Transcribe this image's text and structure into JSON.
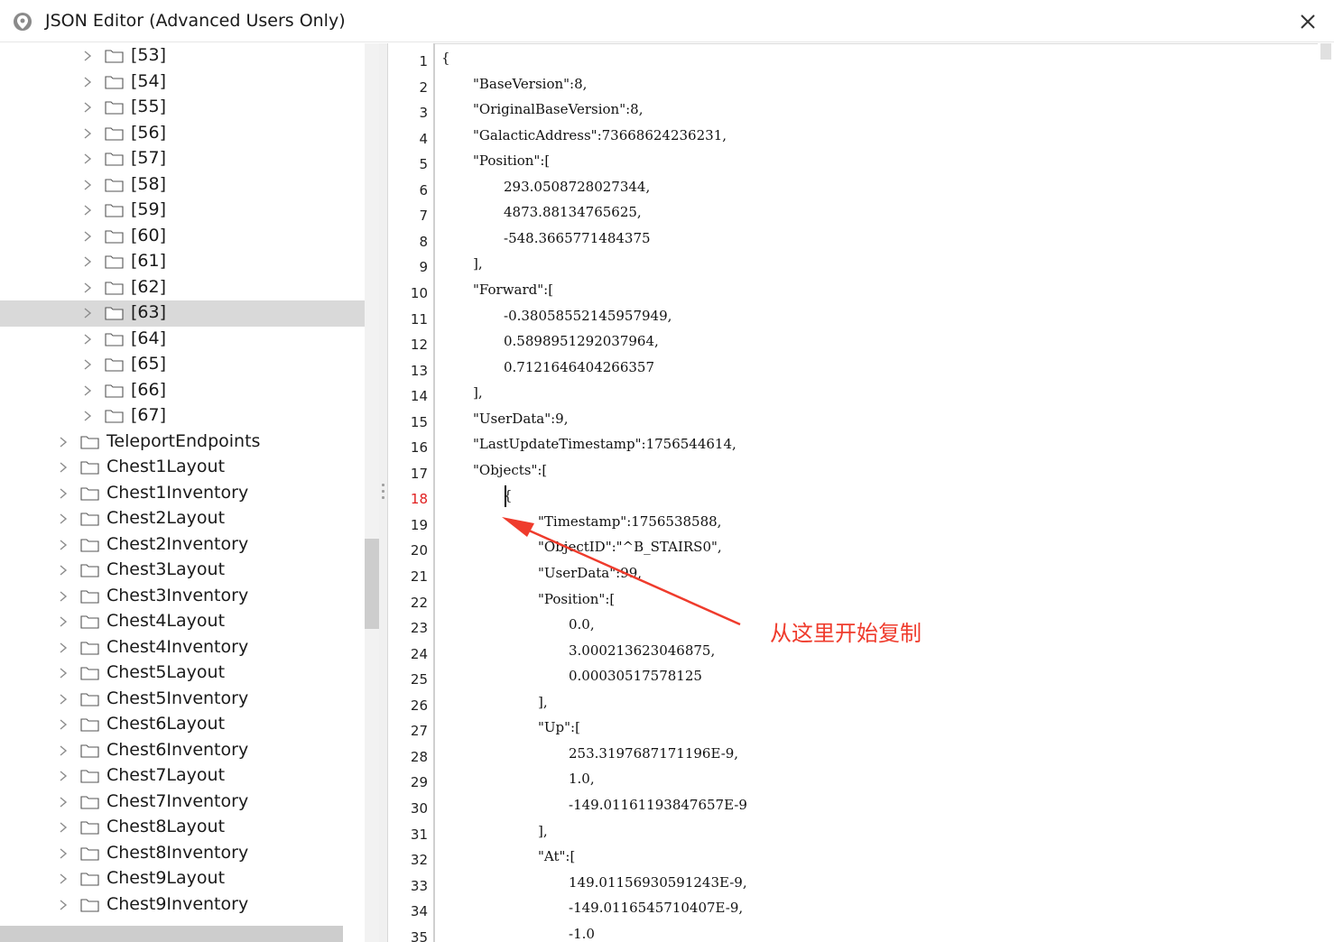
{
  "window": {
    "title": "JSON Editor (Advanced Users Only)"
  },
  "tree": {
    "items": [
      {
        "label": "[53]",
        "level": 2
      },
      {
        "label": "[54]",
        "level": 2
      },
      {
        "label": "[55]",
        "level": 2
      },
      {
        "label": "[56]",
        "level": 2
      },
      {
        "label": "[57]",
        "level": 2
      },
      {
        "label": "[58]",
        "level": 2
      },
      {
        "label": "[59]",
        "level": 2
      },
      {
        "label": "[60]",
        "level": 2
      },
      {
        "label": "[61]",
        "level": 2
      },
      {
        "label": "[62]",
        "level": 2
      },
      {
        "label": "[63]",
        "level": 2,
        "selected": true
      },
      {
        "label": "[64]",
        "level": 2
      },
      {
        "label": "[65]",
        "level": 2
      },
      {
        "label": "[66]",
        "level": 2
      },
      {
        "label": "[67]",
        "level": 2
      },
      {
        "label": "TeleportEndpoints",
        "level": 1
      },
      {
        "label": "Chest1Layout",
        "level": 1
      },
      {
        "label": "Chest1Inventory",
        "level": 1
      },
      {
        "label": "Chest2Layout",
        "level": 1
      },
      {
        "label": "Chest2Inventory",
        "level": 1
      },
      {
        "label": "Chest3Layout",
        "level": 1
      },
      {
        "label": "Chest3Inventory",
        "level": 1
      },
      {
        "label": "Chest4Layout",
        "level": 1
      },
      {
        "label": "Chest4Inventory",
        "level": 1
      },
      {
        "label": "Chest5Layout",
        "level": 1
      },
      {
        "label": "Chest5Inventory",
        "level": 1
      },
      {
        "label": "Chest6Layout",
        "level": 1
      },
      {
        "label": "Chest6Inventory",
        "level": 1
      },
      {
        "label": "Chest7Layout",
        "level": 1
      },
      {
        "label": "Chest7Inventory",
        "level": 1
      },
      {
        "label": "Chest8Layout",
        "level": 1
      },
      {
        "label": "Chest8Inventory",
        "level": 1
      },
      {
        "label": "Chest9Layout",
        "level": 1
      },
      {
        "label": "Chest9Inventory",
        "level": 1
      }
    ]
  },
  "editor": {
    "active_line": 18,
    "lines": [
      {
        "n": "1",
        "indent": 0,
        "text": "{"
      },
      {
        "n": "2",
        "indent": 1,
        "text": "\"BaseVersion\":8,"
      },
      {
        "n": "3",
        "indent": 1,
        "text": "\"OriginalBaseVersion\":8,"
      },
      {
        "n": "4",
        "indent": 1,
        "text": "\"GalacticAddress\":73668624236231,"
      },
      {
        "n": "5",
        "indent": 1,
        "text": "\"Position\":["
      },
      {
        "n": "6",
        "indent": 2,
        "text": "293.0508728027344,"
      },
      {
        "n": "7",
        "indent": 2,
        "text": "4873.88134765625,"
      },
      {
        "n": "8",
        "indent": 2,
        "text": "-548.3665771484375"
      },
      {
        "n": "9",
        "indent": 1,
        "text": "],"
      },
      {
        "n": "10",
        "indent": 1,
        "text": "\"Forward\":["
      },
      {
        "n": "11",
        "indent": 2,
        "text": "-0.38058552145957949,"
      },
      {
        "n": "12",
        "indent": 2,
        "text": "0.5898951292037964,"
      },
      {
        "n": "13",
        "indent": 2,
        "text": "0.7121646404266357"
      },
      {
        "n": "14",
        "indent": 1,
        "text": "],"
      },
      {
        "n": "15",
        "indent": 1,
        "text": "\"UserData\":9,"
      },
      {
        "n": "16",
        "indent": 1,
        "text": "\"LastUpdateTimestamp\":1756544614,"
      },
      {
        "n": "17",
        "indent": 1,
        "text": "\"Objects\":["
      },
      {
        "n": "18",
        "indent": 2,
        "text": "{"
      },
      {
        "n": "19",
        "indent": 3,
        "text": "\"Timestamp\":1756538588,"
      },
      {
        "n": "20",
        "indent": 3,
        "text": "\"ObjectID\":\"^B_STAIRS0\","
      },
      {
        "n": "21",
        "indent": 3,
        "text": "\"UserData\":99,"
      },
      {
        "n": "22",
        "indent": 3,
        "text": "\"Position\":["
      },
      {
        "n": "23",
        "indent": 4,
        "text": "0.0,"
      },
      {
        "n": "24",
        "indent": 4,
        "text": "3.000213623046875,"
      },
      {
        "n": "25",
        "indent": 4,
        "text": "0.00030517578125"
      },
      {
        "n": "26",
        "indent": 3,
        "text": "],"
      },
      {
        "n": "27",
        "indent": 3,
        "text": "\"Up\":["
      },
      {
        "n": "28",
        "indent": 4,
        "text": "253.3197687171196E-9,"
      },
      {
        "n": "29",
        "indent": 4,
        "text": "1.0,"
      },
      {
        "n": "30",
        "indent": 4,
        "text": "-149.01161193847657E-9"
      },
      {
        "n": "31",
        "indent": 3,
        "text": "],"
      },
      {
        "n": "32",
        "indent": 3,
        "text": "\"At\":["
      },
      {
        "n": "33",
        "indent": 4,
        "text": "149.01156930591243E-9,"
      },
      {
        "n": "34",
        "indent": 4,
        "text": "-149.0116545710407E-9,"
      },
      {
        "n": "35",
        "indent": 4,
        "text": "-1.0"
      }
    ]
  },
  "annotation": {
    "text": "从这里开始复制",
    "color": "#ef3b2c"
  },
  "colors": {
    "selection": "#d9d9d9",
    "active_line_number": "#e02020"
  }
}
